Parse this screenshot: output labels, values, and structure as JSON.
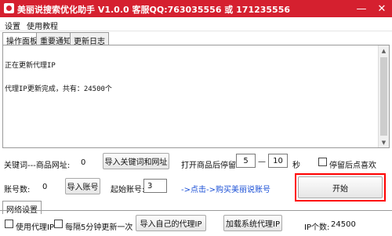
{
  "window": {
    "title": "美丽说搜索优化助手 V1.0.0 客服QQ:763035556 或 171235556"
  },
  "menu": [
    "设置",
    "使用教程"
  ],
  "tabs": [
    "操作面板",
    "重要通知",
    "更新日志"
  ],
  "log": {
    "lines": [
      "正在更新代理IP",
      "代理IP更新完成，共有：24500个"
    ]
  },
  "controls": {
    "keyword_label": "关键词---商品网址:",
    "keyword_count": "0",
    "import_keywords_button": "导入关键词和网址",
    "pause_label": "打开商品后停留:",
    "pause_min": "5",
    "pause_dash": "—",
    "pause_max": "10",
    "pause_unit": "秒",
    "stop_like_label": "停留后点喜欢",
    "stop_like_checked": false,
    "account_label": "账号数:",
    "account_count": "0",
    "import_accounts_button": "导入账号",
    "start_account_label": "起始账号:",
    "start_account_value": "3",
    "buy_account_link": "->点击->购买美丽说账号",
    "start_button": "开始"
  },
  "network": {
    "tab_label": "网络设置",
    "use_proxy_label": "使用代理IP",
    "use_proxy_checked": false,
    "refresh_label": "每隔5分钟更新一次",
    "refresh_checked": false,
    "import_own_proxy_button": "导入自己的代理IP",
    "load_system_proxy_button": "加载系统代理IP",
    "ip_count_label": "IP个数:",
    "ip_count_value": "24500"
  },
  "colors": {
    "titlebar": "#d5202f",
    "highlight_frame": "#ff0000",
    "link": "#1a4fd6"
  }
}
